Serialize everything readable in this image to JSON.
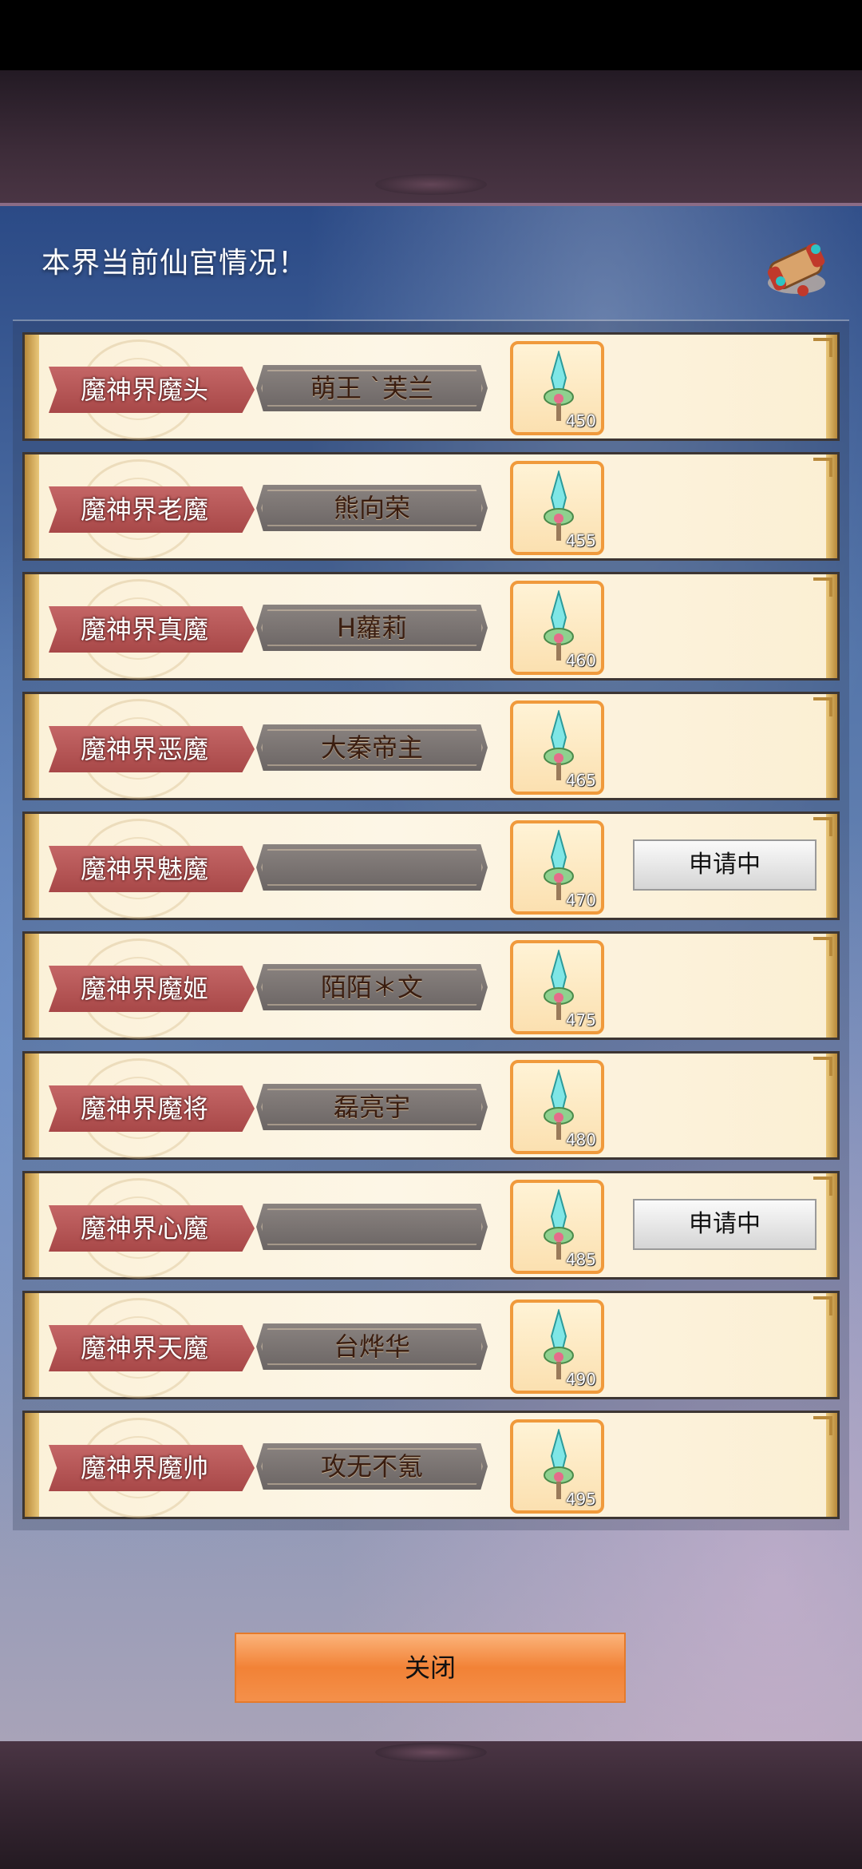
{
  "header": {
    "title": "本界当前仙官情况！"
  },
  "rows": [
    {
      "rank": "魔神界魔头",
      "name": "萌王 `芙兰",
      "item_level": "450",
      "status": ""
    },
    {
      "rank": "魔神界老魔",
      "name": "熊向荣",
      "item_level": "455",
      "status": ""
    },
    {
      "rank": "魔神界真魔",
      "name": "H蘿莉",
      "item_level": "460",
      "status": ""
    },
    {
      "rank": "魔神界恶魔",
      "name": "大秦帝主",
      "item_level": "465",
      "status": ""
    },
    {
      "rank": "魔神界魅魔",
      "name": "",
      "item_level": "470",
      "status": "申请中"
    },
    {
      "rank": "魔神界魔姬",
      "name": "陌陌＊文",
      "item_level": "475",
      "status": ""
    },
    {
      "rank": "魔神界魔将",
      "name": "磊亮宇",
      "item_level": "480",
      "status": ""
    },
    {
      "rank": "魔神界心魔",
      "name": "",
      "item_level": "485",
      "status": "申请中"
    },
    {
      "rank": "魔神界天魔",
      "name": "台烨华",
      "item_level": "490",
      "status": ""
    },
    {
      "rank": "魔神界魔帅",
      "name": "攻无不氪",
      "item_level": "495",
      "status": ""
    }
  ],
  "footer": {
    "close_label": "关闭"
  },
  "icons": {
    "header": "scroll-icon",
    "item": "sword-icon"
  },
  "colors": {
    "rank_ribbon": "#b45555",
    "item_border": "#f09a3c",
    "close_button": "#f28236"
  }
}
